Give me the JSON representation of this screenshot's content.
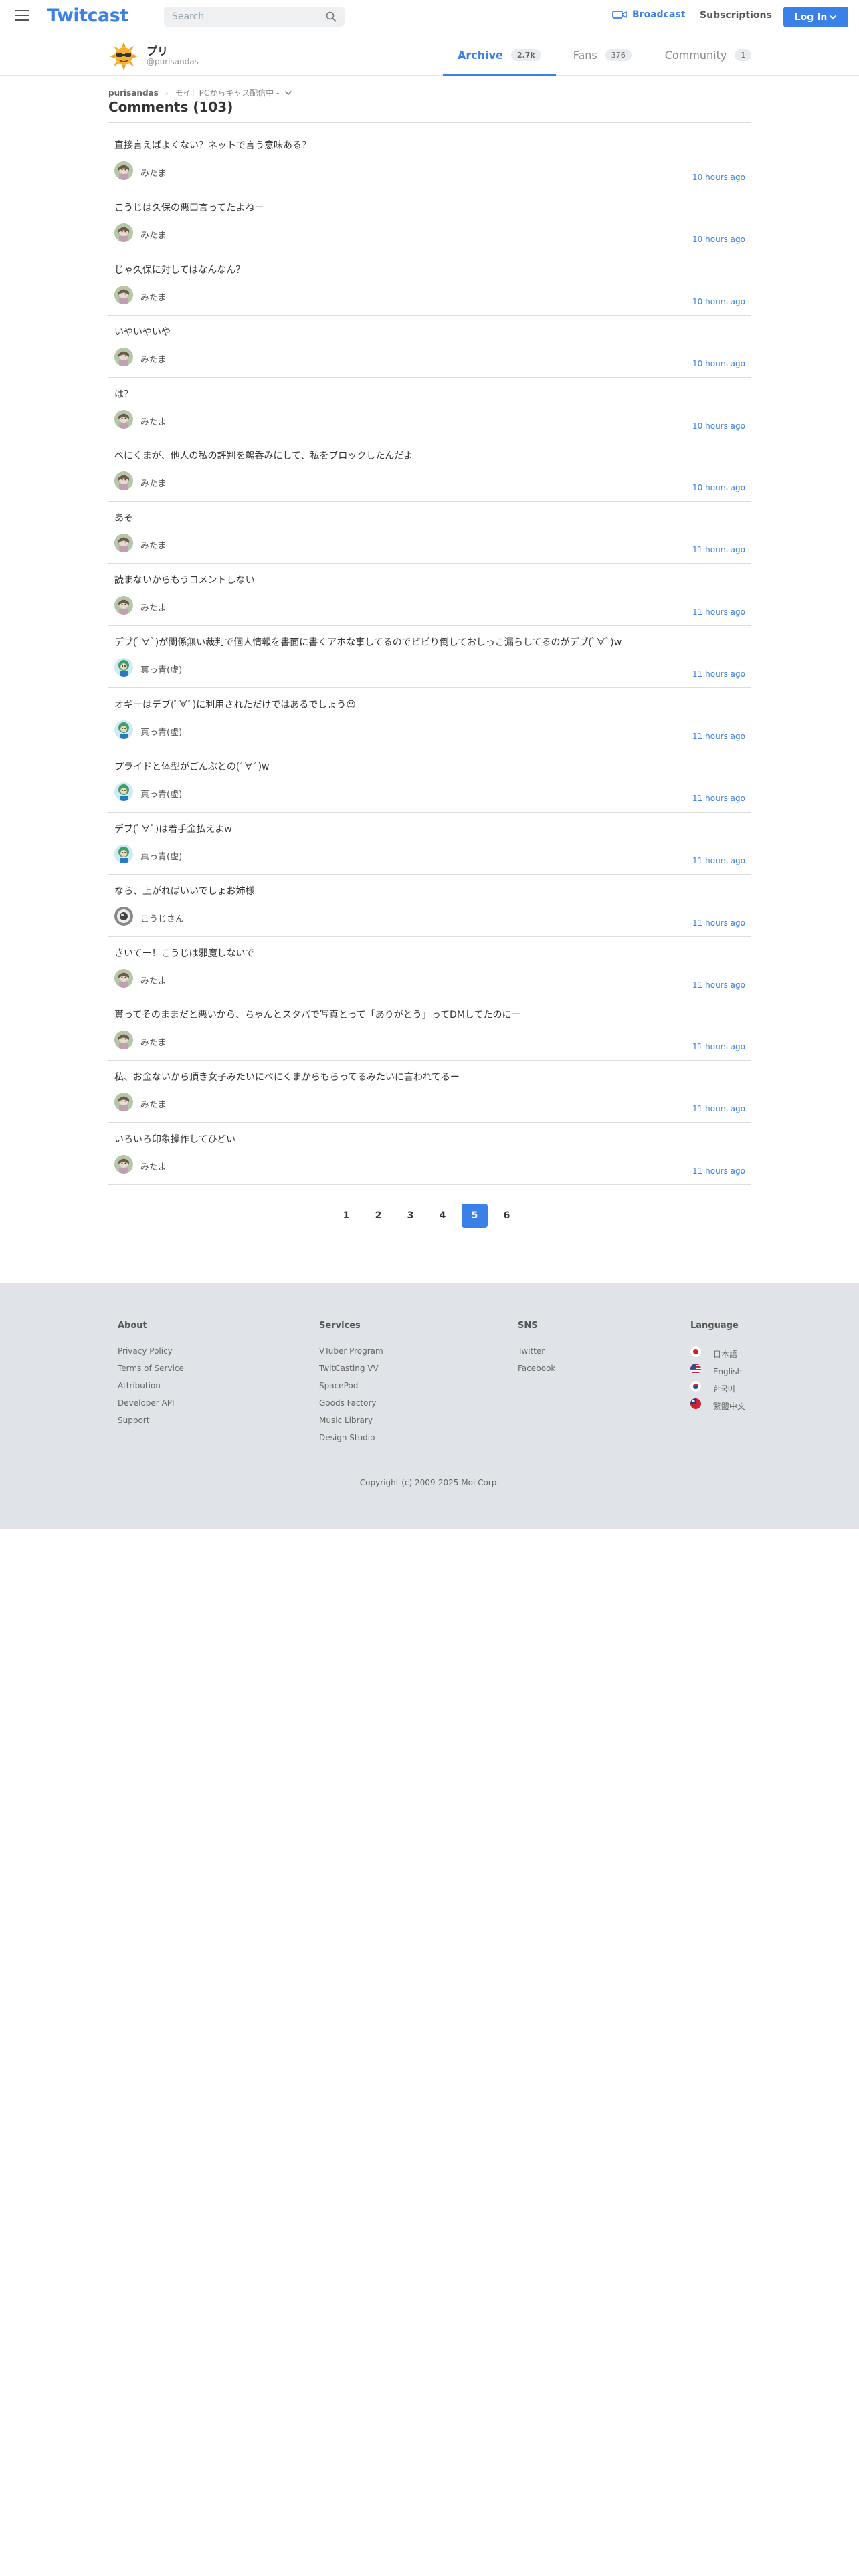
{
  "header": {
    "logo": "Twitcast",
    "search_placeholder": "Search",
    "broadcast_label": "Broadcast",
    "subscriptions_label": "Subscriptions",
    "login_label": "Log In"
  },
  "profile": {
    "name": "プリ",
    "handle": "@purisandas",
    "tabs": [
      {
        "label": "Archive",
        "count": "2.7k",
        "active": true
      },
      {
        "label": "Fans",
        "count": "376",
        "active": false
      },
      {
        "label": "Community",
        "count": "1",
        "active": false
      }
    ]
  },
  "breadcrumb": {
    "user": "purisandas",
    "movie": "モイ！PCからキャス配信中 -"
  },
  "title": "Comments (103)",
  "comments": [
    {
      "text": "直接言えばよくない？ネットで言う意味ある？",
      "user": "みたま",
      "time": "10 hours ago",
      "avatar": "mitama"
    },
    {
      "text": "こうじは久保の悪口言ってたよねー",
      "user": "みたま",
      "time": "10 hours ago",
      "avatar": "mitama"
    },
    {
      "text": "じゃ久保に対してはなんなん？",
      "user": "みたま",
      "time": "10 hours ago",
      "avatar": "mitama"
    },
    {
      "text": "いやいやいや",
      "user": "みたま",
      "time": "10 hours ago",
      "avatar": "mitama"
    },
    {
      "text": "は？",
      "user": "みたま",
      "time": "10 hours ago",
      "avatar": "mitama"
    },
    {
      "text": "べにくまが、他人の私の評判を鵜呑みにして、私をブロックしたんだよ",
      "user": "みたま",
      "time": "10 hours ago",
      "avatar": "mitama"
    },
    {
      "text": "あそ",
      "user": "みたま",
      "time": "11 hours ago",
      "avatar": "mitama"
    },
    {
      "text": "読まないからもうコメントしない",
      "user": "みたま",
      "time": "11 hours ago",
      "avatar": "mitama"
    },
    {
      "text": "デブ(ﾟ∀ﾟ)が関係無い裁判で個人情報を書面に書くアホな事してるのでビビり倒しておしっこ漏らしてるのがデブ(ﾟ∀ﾟ)w",
      "user": "真っ青(虚)",
      "time": "11 hours ago",
      "avatar": "massao"
    },
    {
      "text": "オギーはデブ(ﾟ∀ﾟ)に利用されただけではあるでしょう☺",
      "user": "真っ青(虚)",
      "time": "11 hours ago",
      "avatar": "massao"
    },
    {
      "text": "プライドと体型がごんぶとの(ﾟ∀ﾟ)w",
      "user": "真っ青(虚)",
      "time": "11 hours ago",
      "avatar": "massao"
    },
    {
      "text": "デブ(ﾟ∀ﾟ)は着手金払えよw",
      "user": "真っ青(虚)",
      "time": "11 hours ago",
      "avatar": "massao"
    },
    {
      "text": "なら、上がればいいでしょお姉様",
      "user": "こうじさん",
      "time": "11 hours ago",
      "avatar": "kouji"
    },
    {
      "text": "きいてー！こうじは邪魔しないで",
      "user": "みたま",
      "time": "11 hours ago",
      "avatar": "mitama"
    },
    {
      "text": "貰ってそのままだと悪いから、ちゃんとスタバで写真とって「ありがとう」ってDMしてたのにー",
      "user": "みたま",
      "time": "11 hours ago",
      "avatar": "mitama"
    },
    {
      "text": "私、お金ないから頂き女子みたいにべにくまからもらってるみたいに言われてるー",
      "user": "みたま",
      "time": "11 hours ago",
      "avatar": "mitama"
    },
    {
      "text": "いろいろ印象操作してひどい",
      "user": "みたま",
      "time": "11 hours ago",
      "avatar": "mitama"
    }
  ],
  "pagination": {
    "pages": [
      "1",
      "2",
      "3",
      "4",
      "5",
      "6"
    ],
    "current": "5"
  },
  "footer": {
    "columns": [
      {
        "heading": "About",
        "links": [
          "Privacy Policy",
          "Terms of Service",
          "Attribution",
          "Developer API",
          "Support"
        ]
      },
      {
        "heading": "Services",
        "links": [
          "VTuber Program",
          "TwitCasting VV",
          "SpacePod",
          "Goods Factory",
          "Music Library",
          "Design Studio"
        ]
      },
      {
        "heading": "SNS",
        "links": [
          "Twitter",
          "Facebook"
        ]
      },
      {
        "heading": "Language",
        "links": [
          "日本語",
          "English",
          "한국어",
          "繁體中文"
        ]
      }
    ],
    "copyright": "Copyright (c) 2009-2025 Moi Corp."
  },
  "colors": {
    "accent": "#3b80e8",
    "footer_bg": "#e0e4e8"
  }
}
